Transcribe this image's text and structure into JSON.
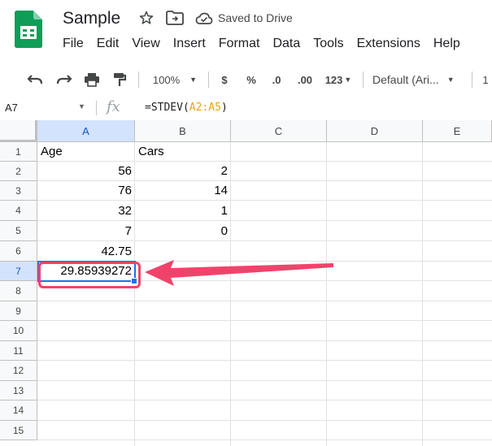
{
  "app": {
    "title": "Sample",
    "saved_status": "Saved to Drive",
    "menus": [
      "File",
      "Edit",
      "View",
      "Insert",
      "Format",
      "Data",
      "Tools",
      "Extensions",
      "Help"
    ]
  },
  "toolbar": {
    "zoom": "100%",
    "currency": "$",
    "percent": "%",
    "decrease_decimal": ".0",
    "increase_decimal": ".00",
    "more_formats": "123",
    "font": "Default (Ari...",
    "font_size": "1"
  },
  "formula_bar": {
    "cell_ref": "A7",
    "fx": "fx",
    "formula_prefix": "=STDEV(",
    "formula_range": "A2:A5",
    "formula_suffix": ")"
  },
  "sheet": {
    "columns": [
      "A",
      "B",
      "C",
      "D",
      "E"
    ],
    "rows": [
      "1",
      "2",
      "3",
      "4",
      "5",
      "6",
      "7",
      "8",
      "9",
      "10",
      "11",
      "12",
      "13",
      "14",
      "15"
    ],
    "cells": {
      "A1": "Age",
      "B1": "Cars",
      "A2": "56",
      "B2": "2",
      "A3": "76",
      "B3": "14",
      "A4": "32",
      "B4": "1",
      "A5": "7",
      "B5": "0",
      "A6": "42.75",
      "A7": "29.85939272"
    },
    "active_cell": "A7"
  },
  "colors": {
    "sheets_green": "#0F9D58",
    "selection_blue": "#1a73e8",
    "annotation_pink": "#f0436b",
    "formula_range": "#e8a40e"
  }
}
